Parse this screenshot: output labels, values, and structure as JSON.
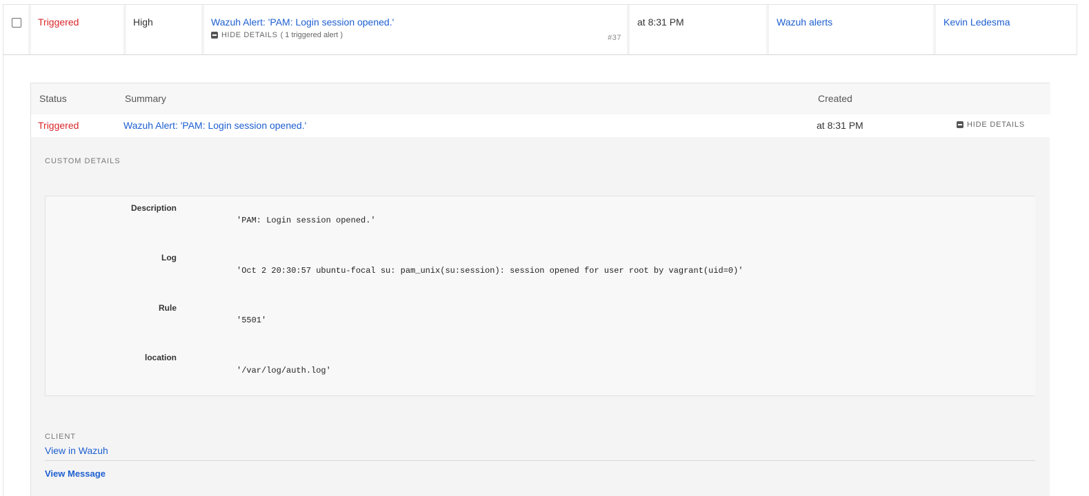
{
  "incident": {
    "status": "Triggered",
    "urgency": "High",
    "title": "Wazuh Alert: 'PAM: Login session opened.'",
    "hide_details": "HIDE DETAILS",
    "triggered_count": "( 1 triggered alert )",
    "number": "#37",
    "created": "at 8:31 PM",
    "service": "Wazuh alerts",
    "assignee": "Kevin Ledesma"
  },
  "alerts_table": {
    "headers": {
      "status": "Status",
      "summary": "Summary",
      "created": "Created"
    },
    "row": {
      "status": "Triggered",
      "summary": "Wazuh Alert: 'PAM: Login session opened.'",
      "created": "at 8:31 PM",
      "hide_details": "HIDE DETAILS"
    }
  },
  "custom_details": {
    "label": "CUSTOM DETAILS",
    "fields": [
      {
        "key": "Description",
        "value": "'PAM: Login session opened.'"
      },
      {
        "key": "Log",
        "value": "'Oct 2 20:30:57 ubuntu-focal su: pam_unix(su:session): session opened for user root by vagrant(uid=0)'"
      },
      {
        "key": "Rule",
        "value": "'5501'"
      },
      {
        "key": "location",
        "value": "'/var/log/auth.log'"
      }
    ]
  },
  "client": {
    "label": "CLIENT",
    "link": "View in Wazuh"
  },
  "view_message": "View Message",
  "colors": {
    "link": "#1d5fd0",
    "triggered": "#d9262a"
  }
}
